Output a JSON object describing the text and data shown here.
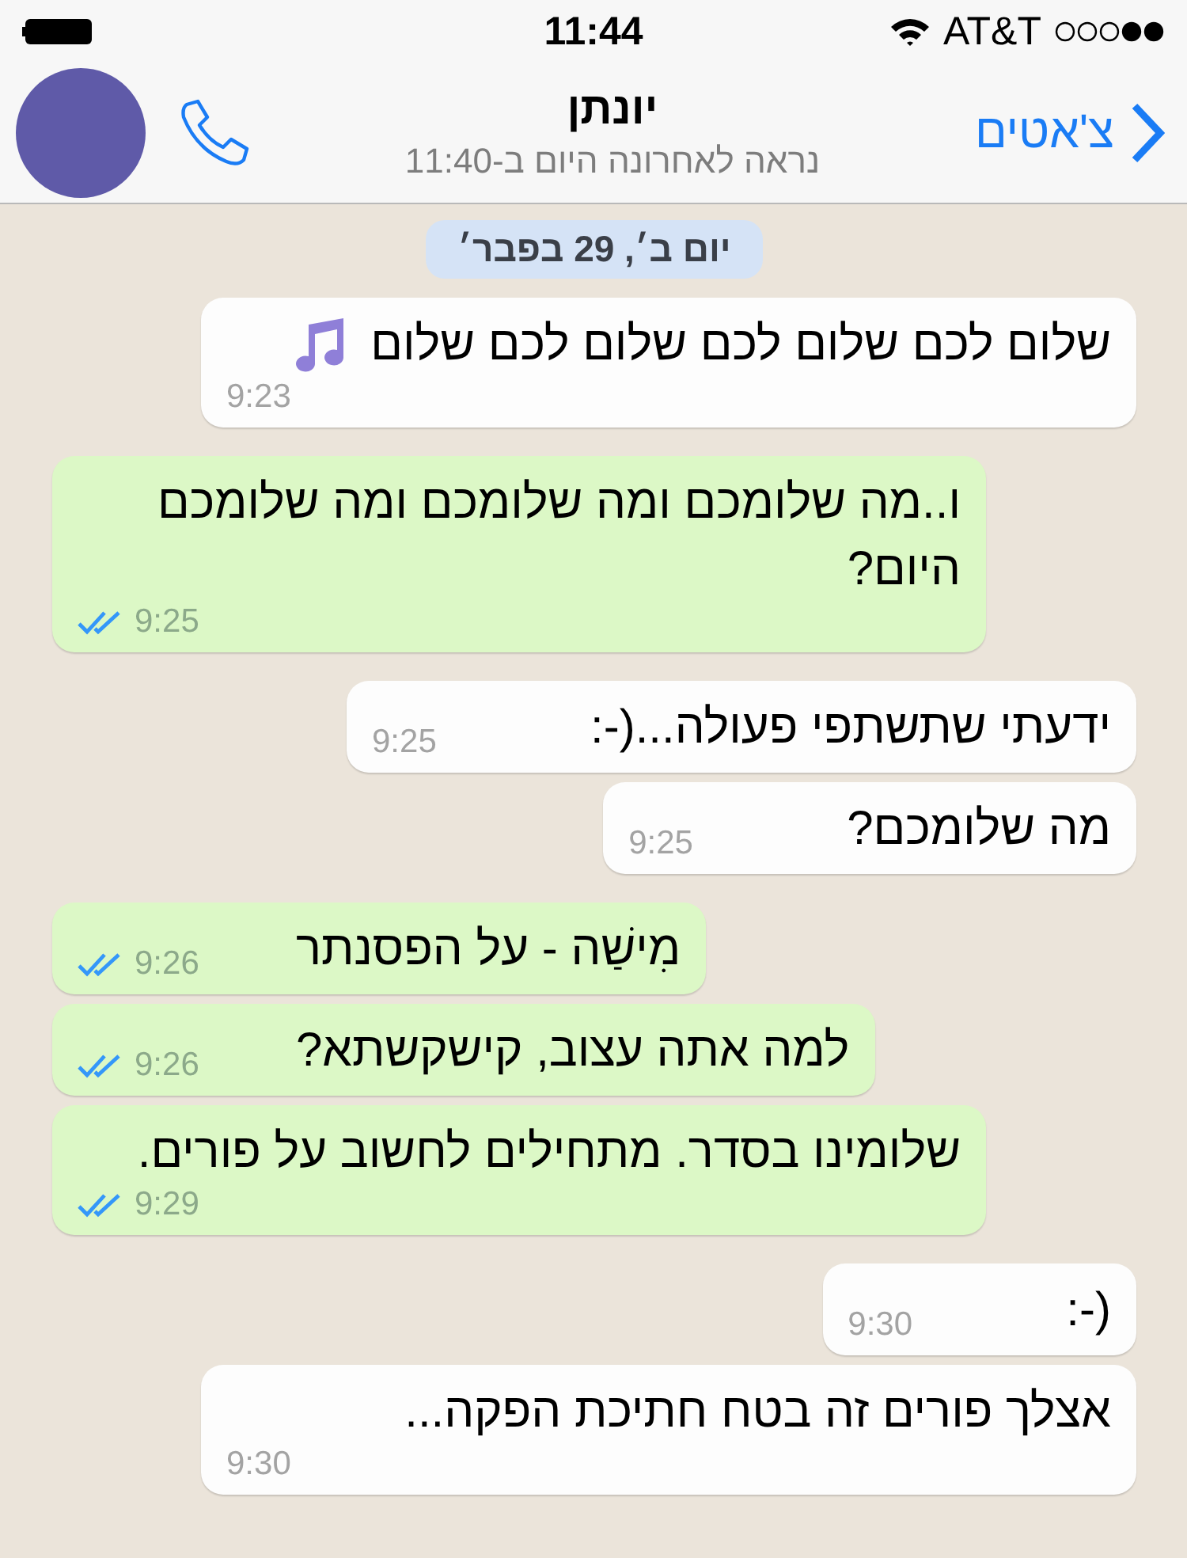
{
  "status_bar": {
    "time": "11:44",
    "carrier": "AT&T"
  },
  "header": {
    "back_label": "צ'אטים",
    "contact_name": "יונתן",
    "last_seen": "נראה לאחרונה היום ב-11:40"
  },
  "date_chip": "יום ב׳, 29 בפבר׳",
  "messages": [
    {
      "kind": "incoming",
      "text": "שלום לכם שלום לכם שלום לכם שלום",
      "note_icon": true,
      "time": "9:23"
    },
    {
      "kind": "outgoing",
      "text": "ו..מה שלומכם ומה שלומכם ומה שלומכם היום?",
      "time": "9:25",
      "read": true
    },
    {
      "kind": "incoming",
      "text": "ידעתי שתשתפי פעולה...(-:",
      "time": "9:25"
    },
    {
      "kind": "incoming",
      "text": "מה שלומכם?",
      "time": "9:25"
    },
    {
      "kind": "outgoing",
      "text": "מִישַׁה - על הפסנתר",
      "time": "9:26",
      "read": true
    },
    {
      "kind": "outgoing",
      "text": "למה אתה עצוב, קישקשתא?",
      "time": "9:26",
      "read": true
    },
    {
      "kind": "outgoing",
      "text": "שלומינו בסדר. מתחילים לחשוב על פורים.",
      "time": "9:29",
      "read": true
    },
    {
      "kind": "incoming",
      "text": "(-:",
      "time": "9:30"
    },
    {
      "kind": "incoming",
      "text": "אצלך פורים זה בטח חתיכת הפקה...",
      "time": "9:30"
    }
  ]
}
